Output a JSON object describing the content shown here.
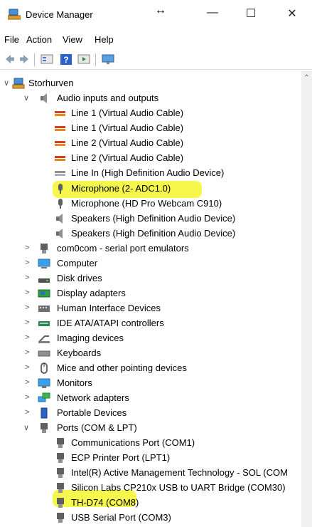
{
  "window": {
    "title": "Device Manager",
    "resize_glyph": "↔",
    "minimize": "—",
    "maximize": "☐",
    "close": "✕"
  },
  "menu": [
    "File",
    "Action",
    "View",
    "Help"
  ],
  "toolbar": [
    "back-icon",
    "forward-icon",
    "properties-icon",
    "help-icon",
    "update-driver-icon",
    "monitor-icon"
  ],
  "tree": {
    "root": "Storhurven",
    "audio": {
      "label": "Audio inputs and outputs",
      "items": [
        "Line 1 (Virtual Audio Cable)",
        "Line 1 (Virtual Audio Cable)",
        "Line 2 (Virtual Audio Cable)",
        "Line 2 (Virtual Audio Cable)",
        "Line In (High Definition Audio Device)",
        "Microphone (2- ADC1.0)",
        "Microphone (HD Pro Webcam C910)",
        "Speakers (High Definition Audio Device)",
        "Speakers (High Definition Audio Device)"
      ]
    },
    "categories": [
      "com0com - serial port emulators",
      "Computer",
      "Disk drives",
      "Display adapters",
      "Human Interface Devices",
      "IDE ATA/ATAPI controllers",
      "Imaging devices",
      "Keyboards",
      "Mice and other pointing devices",
      "Monitors",
      "Network adapters",
      "Portable Devices"
    ],
    "ports": {
      "label": "Ports (COM & LPT)",
      "items": [
        "Communications Port (COM1)",
        "ECP Printer Port (LPT1)",
        "Intel(R) Active Management Technology - SOL (COM",
        "Silicon Labs CP210x USB to UART Bridge (COM30)",
        "TH-D74 (COM8)",
        "USB Serial Port (COM3)"
      ]
    }
  },
  "colors": {
    "highlight": "#f4f63a",
    "folder": "#3a7bd5"
  }
}
